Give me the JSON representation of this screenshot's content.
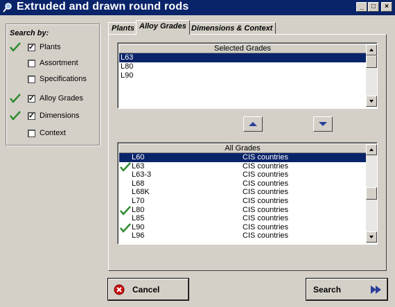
{
  "window": {
    "title": "Extruded and drawn round rods",
    "controls": [
      "_",
      "□",
      "×"
    ]
  },
  "search_by": {
    "title": "Search by:",
    "items": [
      {
        "label": "Plants",
        "checked": true,
        "active": true
      },
      {
        "label": "Assortment",
        "checked": false,
        "active": false
      },
      {
        "label": "Specifications",
        "checked": false,
        "active": false
      },
      {
        "label": "Alloy Grades",
        "checked": true,
        "active": true
      },
      {
        "label": "Dimensions",
        "checked": true,
        "active": true
      },
      {
        "label": "Context",
        "checked": false,
        "active": false
      }
    ]
  },
  "tabs": [
    {
      "label": "Plants",
      "active": false
    },
    {
      "label": "Alloy Grades",
      "active": true
    },
    {
      "label": "Dimensions & Context",
      "active": false
    }
  ],
  "selected_grades": {
    "header": "Selected Grades",
    "rows": [
      "L63",
      "L80",
      "L90"
    ],
    "selected_index": 0
  },
  "all_grades": {
    "header": "All Grades",
    "selected_index": 0,
    "rows": [
      {
        "grade": "L60",
        "region": "CIS countries",
        "checked": false
      },
      {
        "grade": "L63",
        "region": "CIS countries",
        "checked": true
      },
      {
        "grade": "L63-3",
        "region": "CIS countries",
        "checked": false
      },
      {
        "grade": "L68",
        "region": "CIS countries",
        "checked": false
      },
      {
        "grade": "L68K",
        "region": "CIS countries",
        "checked": false
      },
      {
        "grade": "L70",
        "region": "CIS countries",
        "checked": false
      },
      {
        "grade": "L80",
        "region": "CIS countries",
        "checked": true
      },
      {
        "grade": "L85",
        "region": "CIS countries",
        "checked": false
      },
      {
        "grade": "L90",
        "region": "CIS countries",
        "checked": true
      },
      {
        "grade": "L96",
        "region": "CIS countries",
        "checked": false
      }
    ]
  },
  "buttons": {
    "cancel": "Cancel",
    "search": "Search"
  },
  "colors": {
    "titlebar": "#0a246a",
    "selection": "#0a246a",
    "check_green": "#2e8b2e",
    "arrow_blue": "#2a3f9a",
    "cancel_red": "#cc1111"
  }
}
